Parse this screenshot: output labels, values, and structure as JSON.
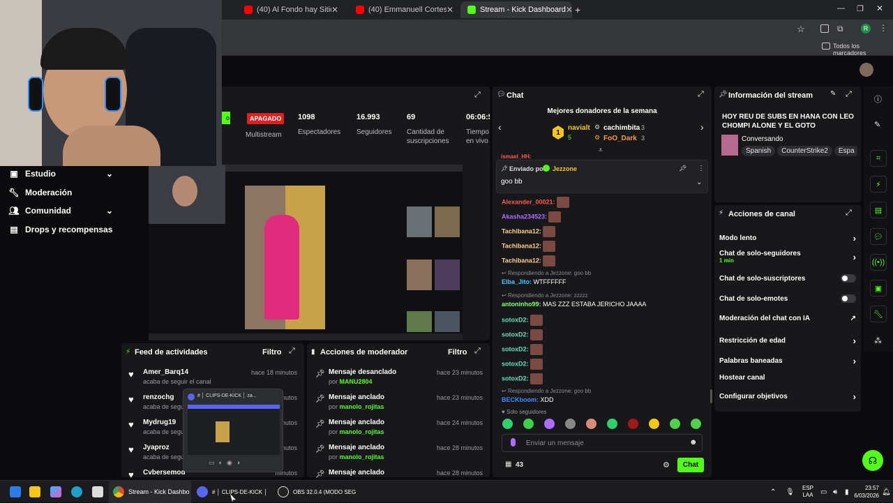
{
  "browser": {
    "tabs": [
      {
        "label": "(40) Al Fondo hay Sitio 8: Joel I"
      },
      {
        "label": "(40) Emmanuell Cortess - Amor"
      },
      {
        "label": "Stream - Kick Dashboard"
      }
    ],
    "new_tab": "+",
    "bookmarks_label": "Todos los marcadores",
    "profile_initial": "R"
  },
  "sidebar": {
    "items": [
      {
        "label": "Estudio"
      },
      {
        "label": "Moderación"
      },
      {
        "label": "Comunidad"
      },
      {
        "label": "Drops y recompensas"
      }
    ]
  },
  "stats": {
    "status_prefix": "o",
    "status_badge": "APAGADO",
    "multistream": "Multistream",
    "viewers": {
      "value": "1098",
      "label": "Espectadores"
    },
    "followers": {
      "value": "16.993",
      "label": "Seguidores"
    },
    "subs": {
      "value": "69",
      "label": "Cantidad de suscripciones"
    },
    "time": {
      "value": "06:06:5",
      "label": "Tiempo en vivo"
    }
  },
  "activity_feed": {
    "title": "Feed de actividades",
    "filter": "Filtro",
    "items": [
      {
        "user": "Amer_Barq14",
        "time": "hace 18 minutos",
        "action": "acaba de seguir el canal"
      },
      {
        "user": "renzochg",
        "time": "minutos",
        "action": "acaba de segu"
      },
      {
        "user": "Mydrug19",
        "time": "minutos",
        "action": "acaba de segu"
      },
      {
        "user": "Jyaproz",
        "time": "minutos",
        "action": "acaba de segu"
      },
      {
        "user": "Cvbersemod",
        "time": "minutos",
        "action": ""
      }
    ]
  },
  "discord_preview": {
    "title": "# │ CLIPS-DE-KICK │ za..."
  },
  "mod_actions": {
    "title": "Acciones de moderador",
    "filter": "Filtro",
    "items": [
      {
        "action": "Mensaje desanclado",
        "by": "por",
        "user": "MANU2804",
        "time": "hace 23 minutos"
      },
      {
        "action": "Mensaje anclado",
        "by": "por",
        "user": "manolo_rojitas",
        "time": "hace 23 minutos"
      },
      {
        "action": "Mensaje anclado",
        "by": "por",
        "user": "manolo_rojitas",
        "time": "hace 24 minutos"
      },
      {
        "action": "Mensaje anclado",
        "by": "por",
        "user": "manolo_rojitas",
        "time": "hace 28 minutos"
      },
      {
        "action": "Mensaje anclado",
        "by": "",
        "user": "",
        "time": "hace 28 minutos"
      }
    ]
  },
  "chat": {
    "title": "Chat",
    "top_donors_title": "Mejores donadores de la semana",
    "donors": [
      {
        "name": "navialt",
        "count": "5"
      },
      {
        "name": "cachimbita",
        "count": "3"
      },
      {
        "name": "FoO_Dark",
        "count": "3"
      }
    ],
    "rank_one": "1",
    "pinned_by_label": "Enviado por",
    "pinned_by_user": "Jezzone",
    "pinned_message": "goo bb",
    "partial_user": "ismael_HH:",
    "messages": [
      {
        "user": "Alexander_00021:",
        "color": "#ff5a4e",
        "text": ""
      },
      {
        "user": "Akasha234523:",
        "color": "#b06bff",
        "text": ""
      },
      {
        "user": "Tachibana12:",
        "color": "#ffcf8a",
        "text": ""
      },
      {
        "user": "Tachibana12:",
        "color": "#ffcf8a",
        "text": ""
      },
      {
        "user": "Tachibana12:",
        "color": "#ffcf8a",
        "text": ""
      },
      {
        "reply": "Respondiendo a Jezzone: goo bb",
        "user": "Elba_Jito:",
        "color": "#3bc9ff",
        "text": " WTFFFFFF"
      },
      {
        "reply": "Respondiendo a Jezzone: zzzzz",
        "user": "antoninho99:",
        "color": "#7dff6a",
        "text": " MAS ZZZ ESTABA JERICHO JAAAA"
      },
      {
        "user": "sotoxD2:",
        "color": "#5fe0b8",
        "text": ""
      },
      {
        "user": "sotoxD2:",
        "color": "#5fe0b8",
        "text": ""
      },
      {
        "user": "sotoxD2:",
        "color": "#5fe0b8",
        "text": ""
      },
      {
        "user": "sotoxD2:",
        "color": "#5fe0b8",
        "text": ""
      },
      {
        "user": "sotoxD2:",
        "color": "#5fe0b8",
        "text": ""
      },
      {
        "reply": "Respondiendo a Jezzone: goo bb",
        "user": "BECKboom:",
        "color": "#3b8bff",
        "text": " XDD"
      }
    ],
    "followers_only": "Solo seguidores",
    "input_placeholder": "Enviar un mensaje",
    "viewer_count": "43",
    "send_button": "Chat"
  },
  "stream_info": {
    "title": "Información del stream",
    "stream_title": "HOY REU DE SUBS EN HANA CON LEO CHOMPI ALONE Y EL GOTO",
    "category": "Conversando",
    "tags": [
      "Spanish",
      "CounterStrike2",
      "Espa"
    ]
  },
  "channel_actions": {
    "title": "Acciones de canal",
    "items": [
      {
        "label": "Modo lento",
        "control": "chevron"
      },
      {
        "label": "Chat de solo-seguidores",
        "sub": "1 min",
        "control": "chevron"
      },
      {
        "label": "Chat de solo-suscriptores",
        "control": "toggle"
      },
      {
        "label": "Chat de solo-emotes",
        "control": "toggle"
      },
      {
        "label": "Moderación del chat con IA",
        "control": "external"
      },
      {
        "label": "Restricción de edad",
        "control": "chevron"
      },
      {
        "label": "Palabras baneadas",
        "control": "chevron"
      },
      {
        "label": "Hostear canal",
        "control": "none"
      },
      {
        "label": "Configurar objetivos",
        "control": "chevron"
      }
    ]
  },
  "taskbar": {
    "chrome_label": "Stream - Kick Dashboard",
    "discord_label": "# │ CLIPS-DE-KICK │",
    "obs_label": "OBS 32.0.4 (MODO SEG",
    "lang": "ESP",
    "lang_sub": "LAA",
    "time": "23:57",
    "date": "6/03/2026"
  },
  "colors": {
    "accent": "#53fc18",
    "panel": "#18181b",
    "badge_red": "#e02020"
  }
}
